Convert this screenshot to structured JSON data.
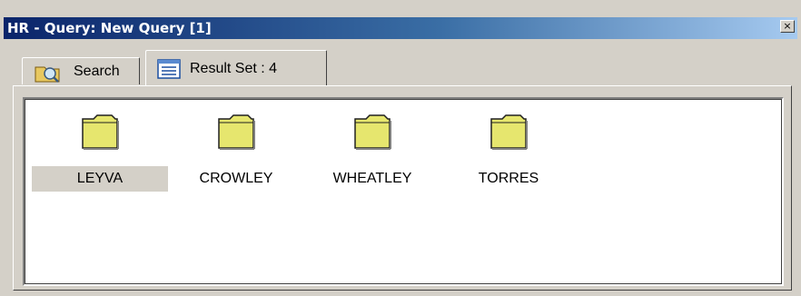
{
  "window": {
    "title": "HR - Query: New Query [1]",
    "close_label": "×"
  },
  "tabs": [
    {
      "label": "Search",
      "icon": "search-folder-icon",
      "active": false
    },
    {
      "label": "Result Set : 4",
      "icon": "list-view-icon",
      "active": true
    }
  ],
  "results": {
    "items": [
      {
        "label": "LEYVA",
        "icon": "folder-icon",
        "selected": true
      },
      {
        "label": "CROWLEY",
        "icon": "folder-icon",
        "selected": false
      },
      {
        "label": "WHEATLEY",
        "icon": "folder-icon",
        "selected": false
      },
      {
        "label": "TORRES",
        "icon": "folder-icon",
        "selected": false
      }
    ]
  },
  "colors": {
    "titlebar_start": "#0a246a",
    "titlebar_end": "#a6caf0",
    "folder_fill": "#e6e66e",
    "selection": "#d4d0c8"
  }
}
